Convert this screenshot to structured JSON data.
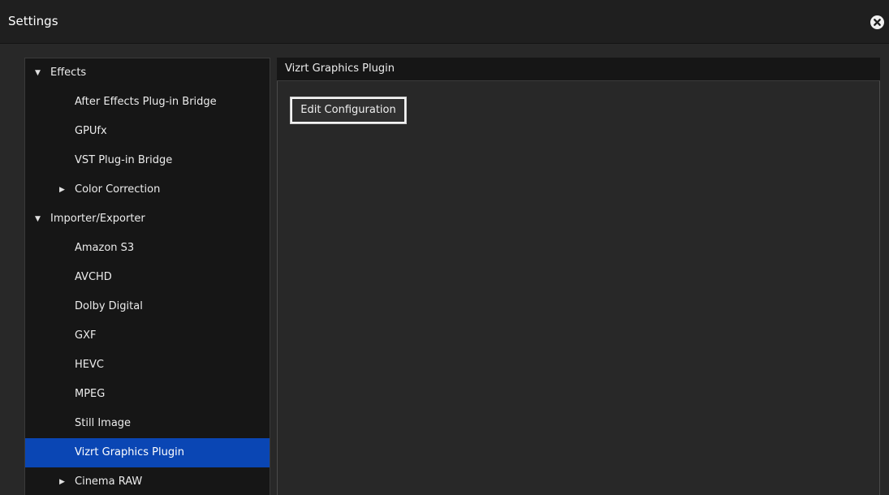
{
  "window": {
    "title": "Settings"
  },
  "icons": {
    "close": "close-circle-icon",
    "expanded": "triangle-down-icon",
    "collapsed": "triangle-right-icon"
  },
  "colors": {
    "selection": "#0a46b4",
    "tree_background": "#161616",
    "window_background": "#282828"
  },
  "tree": {
    "glyphs": {
      "expanded": "▼",
      "collapsed": "▶"
    },
    "items": [
      {
        "label": "Effects",
        "level": 0,
        "state": "expanded"
      },
      {
        "label": "After Effects Plug-in Bridge",
        "level": 1
      },
      {
        "label": "GPUfx",
        "level": 1
      },
      {
        "label": "VST Plug-in Bridge",
        "level": 1
      },
      {
        "label": "Color Correction",
        "level": 1,
        "state": "collapsed"
      },
      {
        "label": "Importer/Exporter",
        "level": 0,
        "state": "expanded"
      },
      {
        "label": "Amazon S3",
        "level": 1
      },
      {
        "label": "AVCHD",
        "level": 1
      },
      {
        "label": "Dolby Digital",
        "level": 1
      },
      {
        "label": "GXF",
        "level": 1
      },
      {
        "label": "HEVC",
        "level": 1
      },
      {
        "label": "MPEG",
        "level": 1
      },
      {
        "label": "Still Image",
        "level": 1
      },
      {
        "label": "Vizrt Graphics Plugin",
        "level": 1,
        "selected": true
      },
      {
        "label": "Cinema RAW",
        "level": 1,
        "state": "collapsed"
      }
    ]
  },
  "panel": {
    "title": "Vizrt Graphics Plugin",
    "edit_button_label": "Edit Configuration"
  }
}
